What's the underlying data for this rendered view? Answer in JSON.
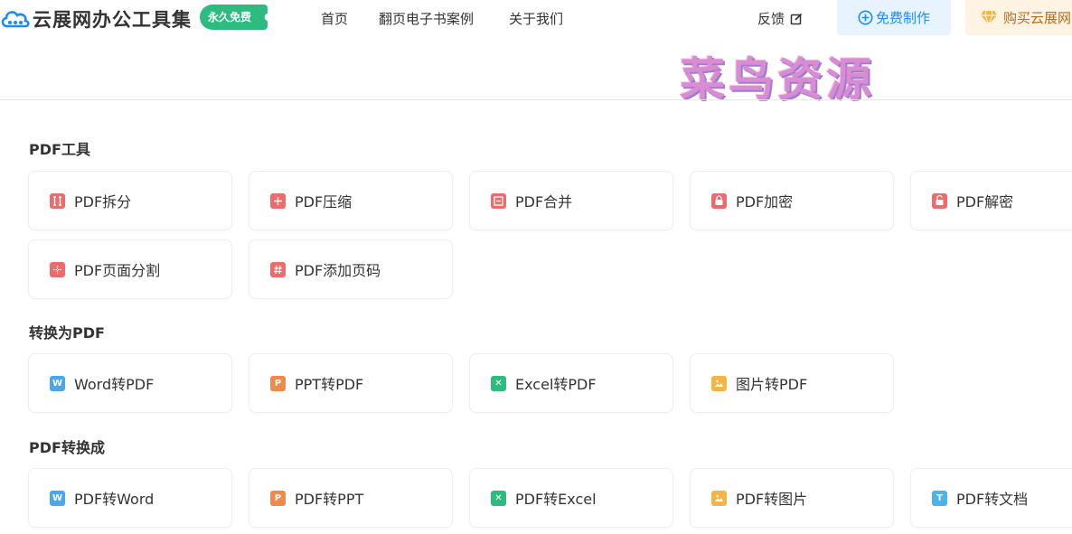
{
  "header": {
    "brand": "云展网办公工具集",
    "badge": "永久免费",
    "nav": [
      "首页",
      "翻页电子书案例",
      "关于我们"
    ],
    "feedback": "反馈",
    "make_button": "免费制作",
    "buy_button": "购买云展网"
  },
  "watermark": "菜鸟资源",
  "colors": {
    "pdf_red": "#ef6b6b",
    "word_blue": "#4aa6ee",
    "ppt_orange": "#f08a4b",
    "excel_green": "#2dbb7f",
    "image_yellow": "#f5b445",
    "text_cyan": "#4ab3e8",
    "brand_green": "#2dbb7f",
    "make_blue": "#1a8bff"
  },
  "sections": [
    {
      "title": "PDF工具",
      "items": [
        {
          "label": "PDF拆分",
          "icon": "pdf-split-icon"
        },
        {
          "label": "PDF压缩",
          "icon": "pdf-compress-icon"
        },
        {
          "label": "PDF合并",
          "icon": "pdf-merge-icon"
        },
        {
          "label": "PDF加密",
          "icon": "pdf-lock-icon"
        },
        {
          "label": "PDF解密",
          "icon": "pdf-unlock-icon"
        },
        {
          "label": "PDF页面分割",
          "icon": "pdf-page-split-icon"
        },
        {
          "label": "PDF添加页码",
          "icon": "pdf-page-number-icon"
        }
      ]
    },
    {
      "title": "转换为PDF",
      "items": [
        {
          "label": "Word转PDF",
          "icon": "word-icon"
        },
        {
          "label": "PPT转PDF",
          "icon": "ppt-icon"
        },
        {
          "label": "Excel转PDF",
          "icon": "excel-icon"
        },
        {
          "label": "图片转PDF",
          "icon": "image-icon"
        }
      ]
    },
    {
      "title": "PDF转换成",
      "items": [
        {
          "label": "PDF转Word",
          "icon": "word-icon"
        },
        {
          "label": "PDF转PPT",
          "icon": "ppt-icon"
        },
        {
          "label": "PDF转Excel",
          "icon": "excel-icon"
        },
        {
          "label": "PDF转图片",
          "icon": "image-icon"
        },
        {
          "label": "PDF转文档",
          "icon": "text-icon"
        }
      ]
    }
  ]
}
